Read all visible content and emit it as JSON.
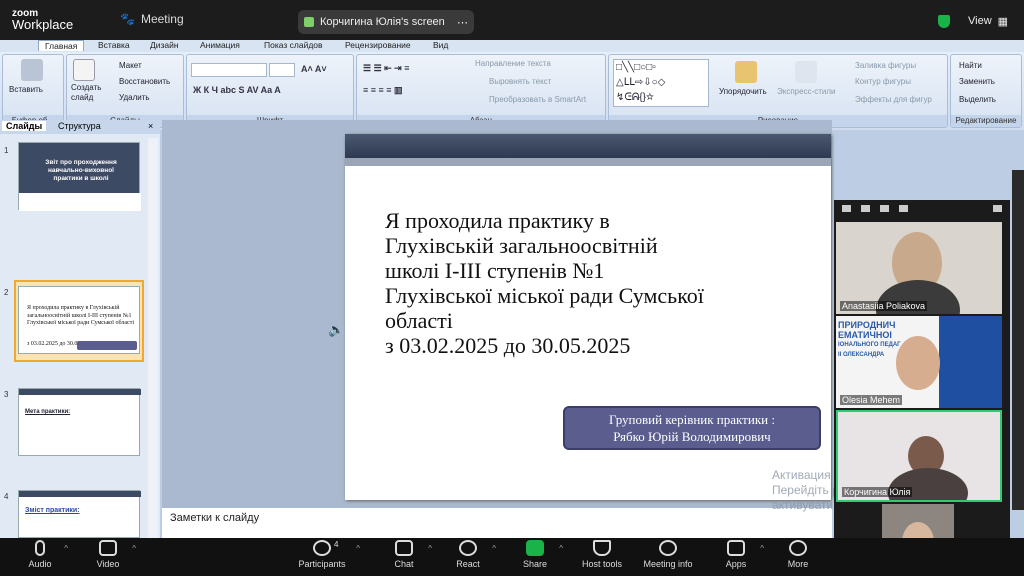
{
  "zoom": {
    "brand_top": "zoom",
    "brand_bottom": "Workplace",
    "meeting_label": "Meeting",
    "share_label": "Корчигина Юлія's screen",
    "view_label": "View",
    "bottom": {
      "audio": "Audio",
      "video": "Video",
      "participants": "Participants",
      "participants_count": "4",
      "chat": "Chat",
      "react": "React",
      "share": "Share",
      "host_tools": "Host tools",
      "meeting_info": "Meeting info",
      "apps": "Apps",
      "more": "More"
    },
    "participants": [
      {
        "name": "Anastasiia Poliakova"
      },
      {
        "name": "Olesia Mehem"
      },
      {
        "name": "Корчигина Юлія"
      }
    ],
    "tile_background_text": [
      "ПРИРОДНИЧ",
      "ЕМАТИЧНОІ",
      "ІОНАЛЬНОГО ПЕДАГ",
      "ІІ ОЛЕКСАНДРА"
    ]
  },
  "ppt": {
    "menu": [
      "Главная",
      "Вставка",
      "Дизайн",
      "Анимация",
      "Показ слайдов",
      "Рецензирование",
      "Вид"
    ],
    "ribbon": {
      "paste": "Вставить",
      "clipboard": "Буфер об...",
      "new_slide": "Создать слайд",
      "layout": "Макет",
      "reset": "Восстановить",
      "delete": "Удалить",
      "slides_group": "Слайды",
      "font_group": "Шрифт",
      "paragraph_group": "Абзац",
      "text_direction": "Направление текста",
      "align_text": "Выровнять текст",
      "smartart": "Преобразовать в SmartArt",
      "arrange": "Упорядочить",
      "quick_styles": "Экспресс-стили",
      "shape_fill": "Заливка фигуры",
      "shape_outline": "Контур фигуры",
      "shape_effects": "Эффекты для фигур",
      "drawing_group": "Рисование",
      "find": "Найти",
      "replace": "Заменить",
      "select": "Выделить",
      "editing_group": "Редактирование"
    },
    "left_tabs": {
      "slides": "Слайды",
      "outline": "Структура"
    },
    "thumbnails": [
      {
        "num": "1",
        "title": "Звіт про проходження навчально-виховної практики в школі"
      },
      {
        "num": "2",
        "text": "Я проходила практику в Глухівській загальноосвітній школі І-ІІІ ступенів №1 Глухівської міської ради Сумської області",
        "dates": "з 03.02.2025  до 30.05.2025"
      },
      {
        "num": "3",
        "title": "Мета практики:"
      },
      {
        "num": "4",
        "title": "Зміст практики:"
      }
    ],
    "slide": {
      "lines": [
        "Я проходила практику в",
        "Глухівській загальноосвітній",
        "школі І-ІІІ ступенів №1",
        "Глухівської міської ради Сумської",
        "області",
        "з 03.02.2025  до 30.05.2025"
      ],
      "leader_line1": "Груповий керівник практики :",
      "leader_line2": "Рябко Юрій Володимирович"
    },
    "notes": "Заметки к слайду",
    "activation_line1": "Активация W",
    "activation_line2": "Перейдіть              ройки\", щоб",
    "activation_line3": "активувати Windows."
  }
}
